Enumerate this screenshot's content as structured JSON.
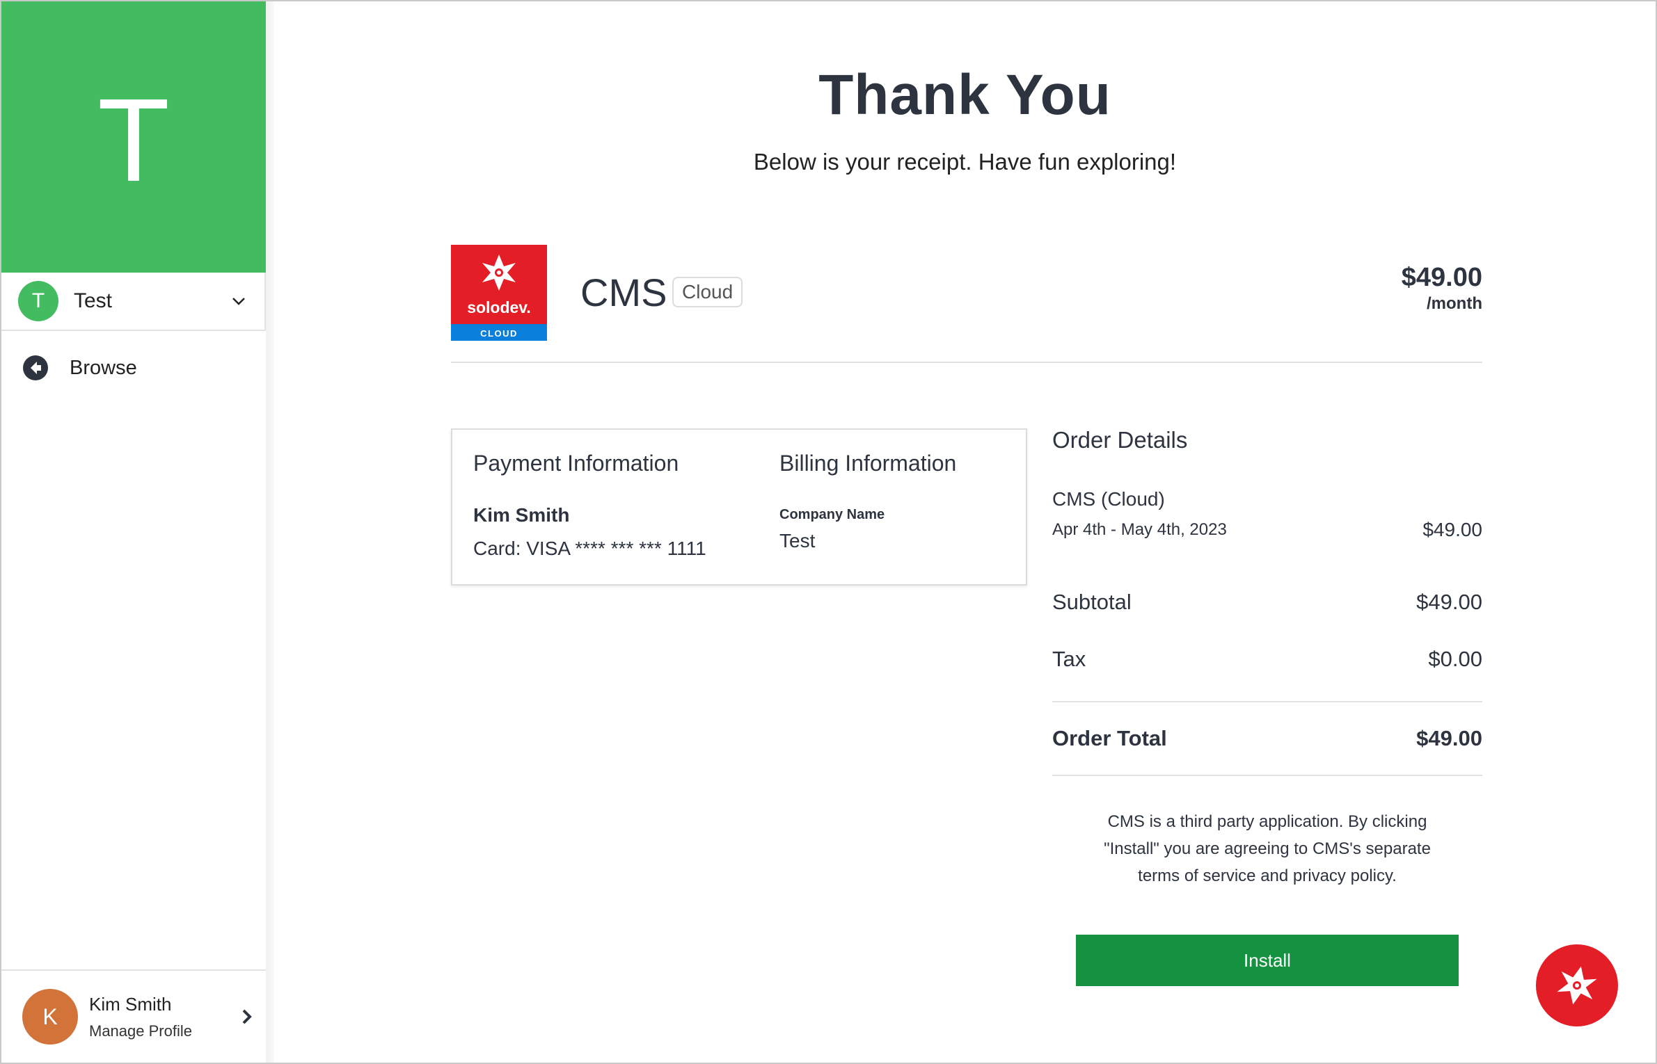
{
  "sidebar": {
    "org_initial": "T",
    "org_switcher": {
      "initial": "T",
      "name": "Test"
    },
    "nav": [
      {
        "label": "Browse",
        "icon": "arrow-left-circle-icon"
      }
    ],
    "profile": {
      "initial": "K",
      "name": "Kim Smith",
      "subtitle": "Manage Profile"
    }
  },
  "header": {
    "title": "Thank You",
    "subtitle": "Below is your receipt. Have fun exploring!"
  },
  "product": {
    "logo_text": "solodev.",
    "logo_sub": "CLOUD",
    "name": "CMS",
    "badge": "Cloud",
    "price": "$49.00",
    "period": "/month"
  },
  "payment": {
    "heading": "Payment Information",
    "name": "Kim Smith",
    "card": "Card: VISA **** *** *** 1111"
  },
  "billing": {
    "heading": "Billing Information",
    "label": "Company Name",
    "value": "Test"
  },
  "order": {
    "heading": "Order Details",
    "item_name": "CMS (Cloud)",
    "item_dates": "Apr 4th - May 4th, 2023",
    "item_price": "$49.00",
    "subtotal_label": "Subtotal",
    "subtotal": "$49.00",
    "tax_label": "Tax",
    "tax": "$0.00",
    "total_label": "Order Total",
    "total": "$49.00",
    "terms": "CMS is a third party application. By clicking \"Install\" you are agreeing to CMS's separate terms of service and privacy policy.",
    "install_label": "Install"
  },
  "colors": {
    "brand_green": "#43bb61",
    "button_green": "#14923f",
    "solodev_red": "#e41e26",
    "solodev_blue": "#0a7fdc",
    "avatar_orange": "#d2733a"
  }
}
